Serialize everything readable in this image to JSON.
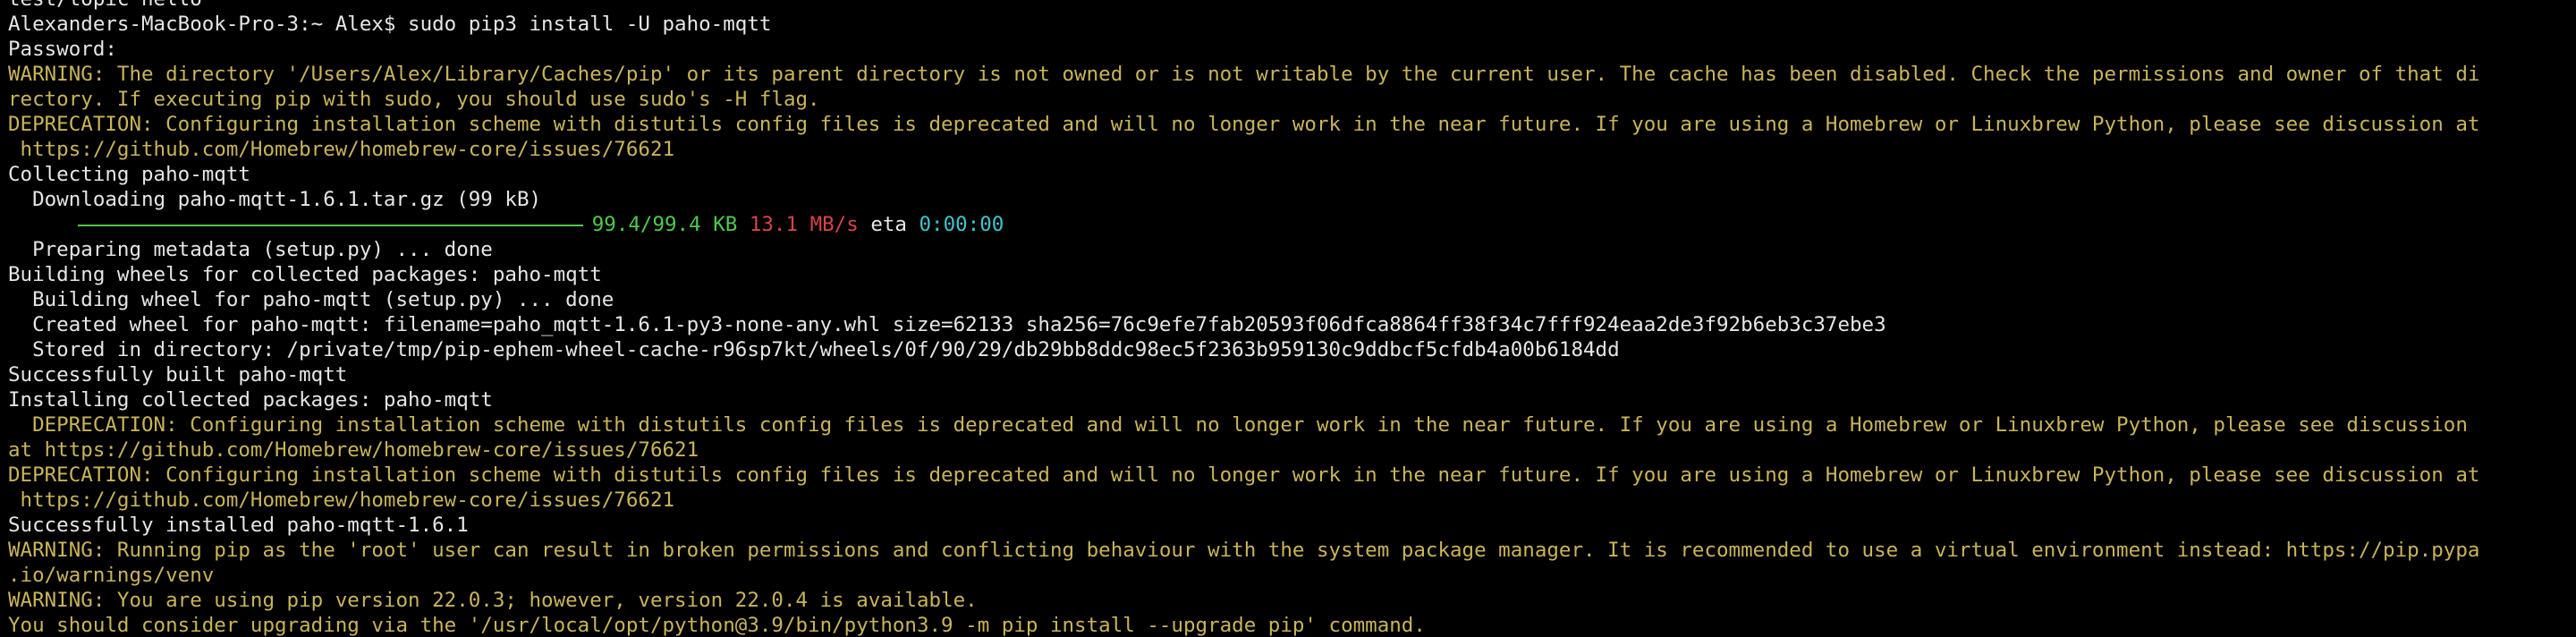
{
  "colors": {
    "background": "#000000",
    "default_text": "#e6e6e6",
    "warning_text": "#c9b458",
    "progress_green": "#4ec94e",
    "speed_red": "#d64545",
    "eta_cyan": "#3ec5d1"
  },
  "lines": {
    "l0": "test/topic hello",
    "l1": "Alexanders-MacBook-Pro-3:~ Alex$ sudo pip3 install -U paho-mqtt",
    "l2": "Password:",
    "l3": "WARNING: The directory '/Users/Alex/Library/Caches/pip' or its parent directory is not owned or is not writable by the current user. The cache has been disabled. Check the permissions and owner of that di",
    "l4": "rectory. If executing pip with sudo, you should use sudo's -H flag.",
    "l5": "DEPRECATION: Configuring installation scheme with distutils config files is deprecated and will no longer work in the near future. If you are using a Homebrew or Linuxbrew Python, please see discussion at",
    "l6": " https://github.com/Homebrew/homebrew-core/issues/76621",
    "l7": "Collecting paho-mqtt",
    "l8": "  Downloading paho-mqtt-1.6.1.tar.gz (99 kB)",
    "l9": {
      "prefix": "     ",
      "progress_fraction": 1.0,
      "size": "99.4/99.4 KB",
      "speed": "13.1 MB/s",
      "eta_label": "eta",
      "eta": "0:00:00"
    },
    "l10": "  Preparing metadata (setup.py) ... done",
    "l11": "Building wheels for collected packages: paho-mqtt",
    "l12": "  Building wheel for paho-mqtt (setup.py) ... done",
    "l13": "  Created wheel for paho-mqtt: filename=paho_mqtt-1.6.1-py3-none-any.whl size=62133 sha256=76c9efe7fab20593f06dfca8864ff38f34c7fff924eaa2de3f92b6eb3c37ebe3",
    "l14": "  Stored in directory: /private/tmp/pip-ephem-wheel-cache-r96sp7kt/wheels/0f/90/29/db29bb8ddc98ec5f2363b959130c9ddbcf5cfdb4a00b6184dd",
    "l15": "Successfully built paho-mqtt",
    "l16": "Installing collected packages: paho-mqtt",
    "l17": "  DEPRECATION: Configuring installation scheme with distutils config files is deprecated and will no longer work in the near future. If you are using a Homebrew or Linuxbrew Python, please see discussion",
    "l18": "at https://github.com/Homebrew/homebrew-core/issues/76621",
    "l19": "DEPRECATION: Configuring installation scheme with distutils config files is deprecated and will no longer work in the near future. If you are using a Homebrew or Linuxbrew Python, please see discussion at",
    "l20": " https://github.com/Homebrew/homebrew-core/issues/76621",
    "l21": "Successfully installed paho-mqtt-1.6.1",
    "l22": "WARNING: Running pip as the 'root' user can result in broken permissions and conflicting behaviour with the system package manager. It is recommended to use a virtual environment instead: https://pip.pypa",
    "l23": ".io/warnings/venv",
    "l24": "WARNING: You are using pip version 22.0.3; however, version 22.0.4 is available.",
    "l25": "You should consider upgrading via the '/usr/local/opt/python@3.9/bin/python3.9 -m pip install --upgrade pip' command."
  }
}
